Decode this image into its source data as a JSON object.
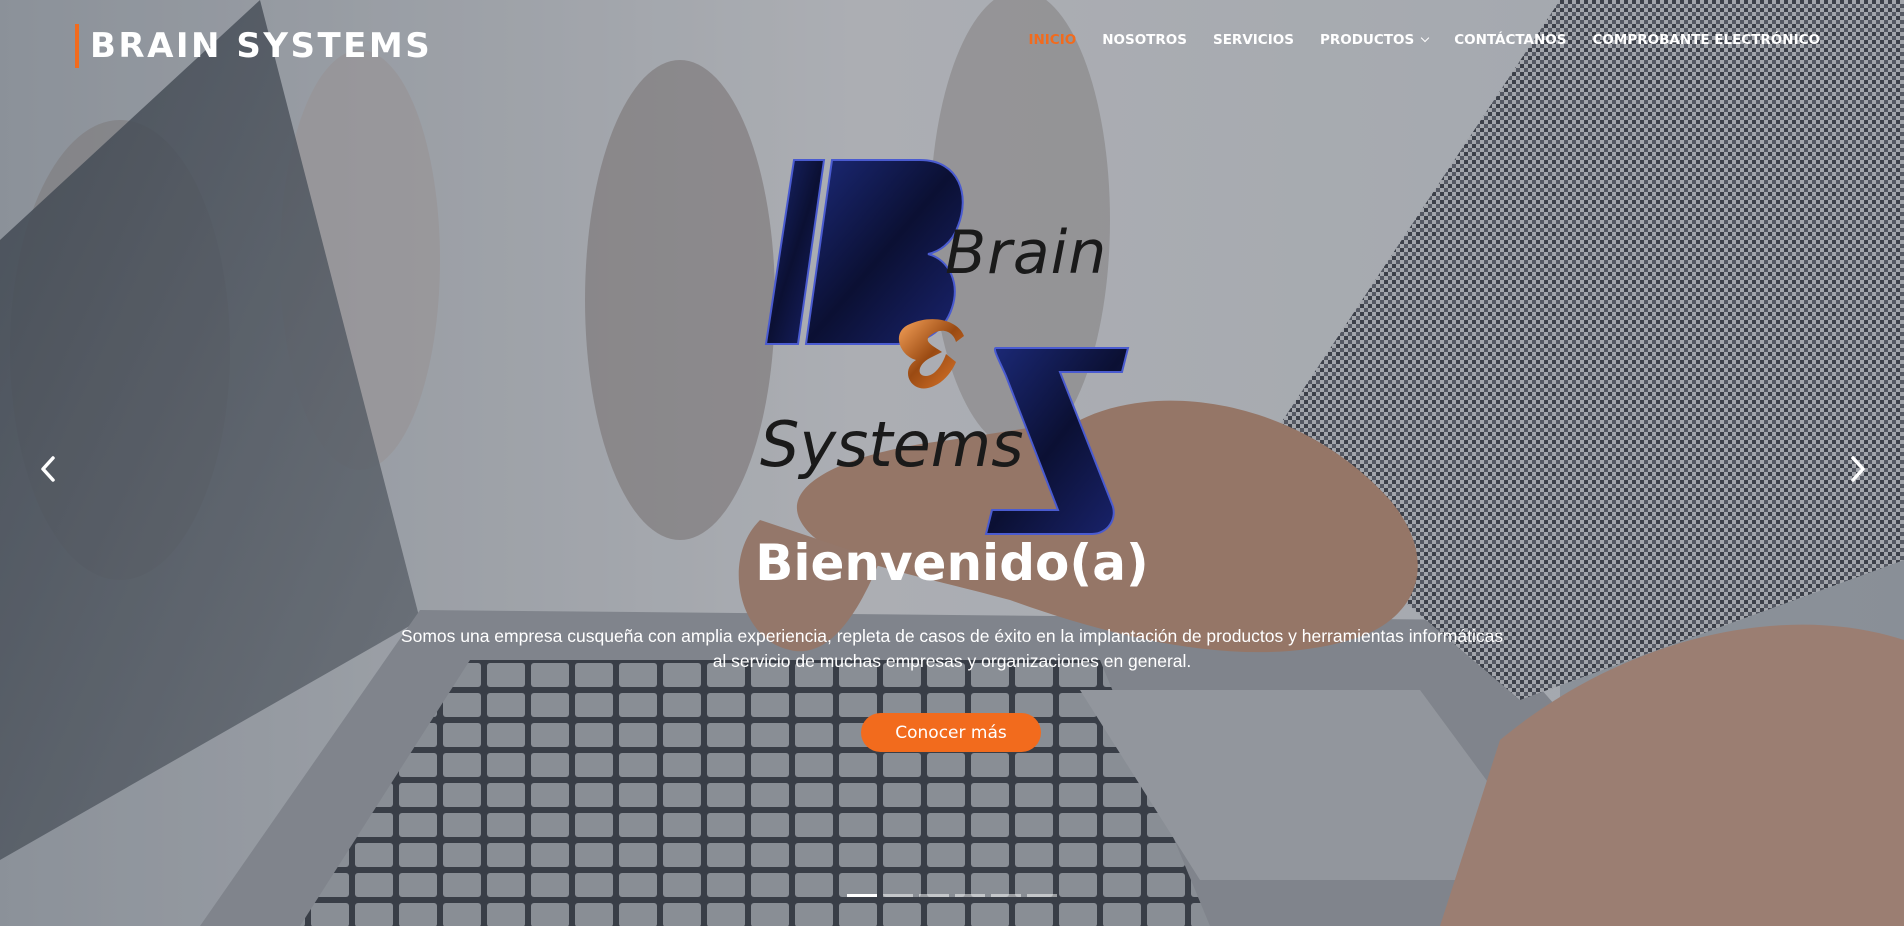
{
  "header": {
    "brand": "BRAIN SYSTEMS",
    "nav": [
      {
        "label": "INICIO",
        "active": true
      },
      {
        "label": "NOSOTROS"
      },
      {
        "label": "SERVICIOS"
      },
      {
        "label": "PRODUCTOS",
        "has_dropdown": true
      },
      {
        "label": "CONTÁCTANOS"
      },
      {
        "label": "COMPROBANTE ELECTRÓNICO"
      }
    ]
  },
  "hero": {
    "logo": {
      "word_top": "Brain",
      "word_bottom": "Systems",
      "letters": [
        "B",
        "S"
      ],
      "ampersand": "&"
    },
    "title": "Bienvenido(a)",
    "description": "Somos una empresa cusqueña con amplia experiencia, repleta de casos de éxito en la implantación de productos y herramientas informáticas al servicio de muchas empresas y organizaciones en general.",
    "cta_label": "Conocer más",
    "prev_icon": "chevron-left-icon",
    "next_icon": "chevron-right-icon",
    "slides_total": 6,
    "active_slide": 1
  },
  "colors": {
    "accent": "#f26b1d",
    "logo_navy": "#0f1a4a",
    "text": "#ffffff"
  }
}
